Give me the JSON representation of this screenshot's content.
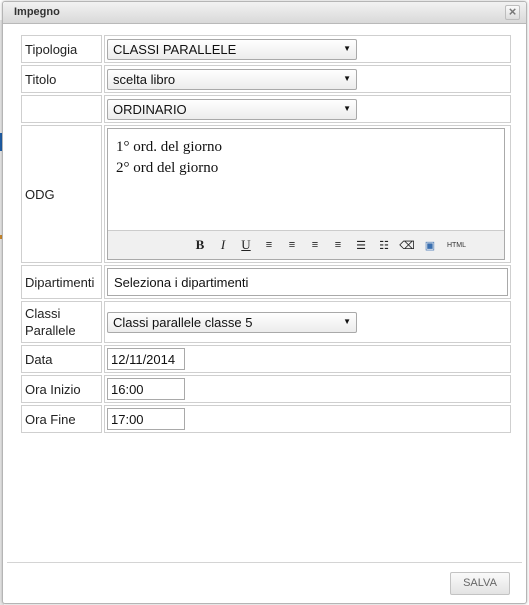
{
  "dialog": {
    "title": "Impegno",
    "close_icon": "close-icon"
  },
  "fields": {
    "tipologia": {
      "label": "Tipologia",
      "value": "CLASSI PARALLELE"
    },
    "titolo": {
      "label": "Titolo",
      "value": "scelta libro"
    },
    "tipo": {
      "value": "ORDINARIO"
    },
    "odg": {
      "label": "ODG",
      "lines": [
        "1° ord. del giorno",
        "2° ord del giorno"
      ]
    },
    "dipartimenti": {
      "label": "Dipartimenti",
      "value": "Seleziona i dipartimenti"
    },
    "classi_parallele": {
      "label_line1": "Classi",
      "label_line2": "Parallele",
      "value": "Classi parallele classe 5"
    },
    "data": {
      "label": "Data",
      "value": "12/11/2014"
    },
    "ora_inizio": {
      "label": "Ora Inizio",
      "value": "16:00"
    },
    "ora_fine": {
      "label": "Ora Fine",
      "value": "17:00"
    }
  },
  "editor_toolbar": {
    "bold": "B",
    "italic": "I",
    "underline": "U",
    "align_left": "≡",
    "align_center": "≡",
    "align_right": "≡",
    "justify": "≡",
    "bullet_list": "☰",
    "numbered_list": "☷",
    "eraser": "⌫",
    "image": "▣",
    "html": "HTML"
  },
  "footer": {
    "save_label": "SALVA"
  }
}
